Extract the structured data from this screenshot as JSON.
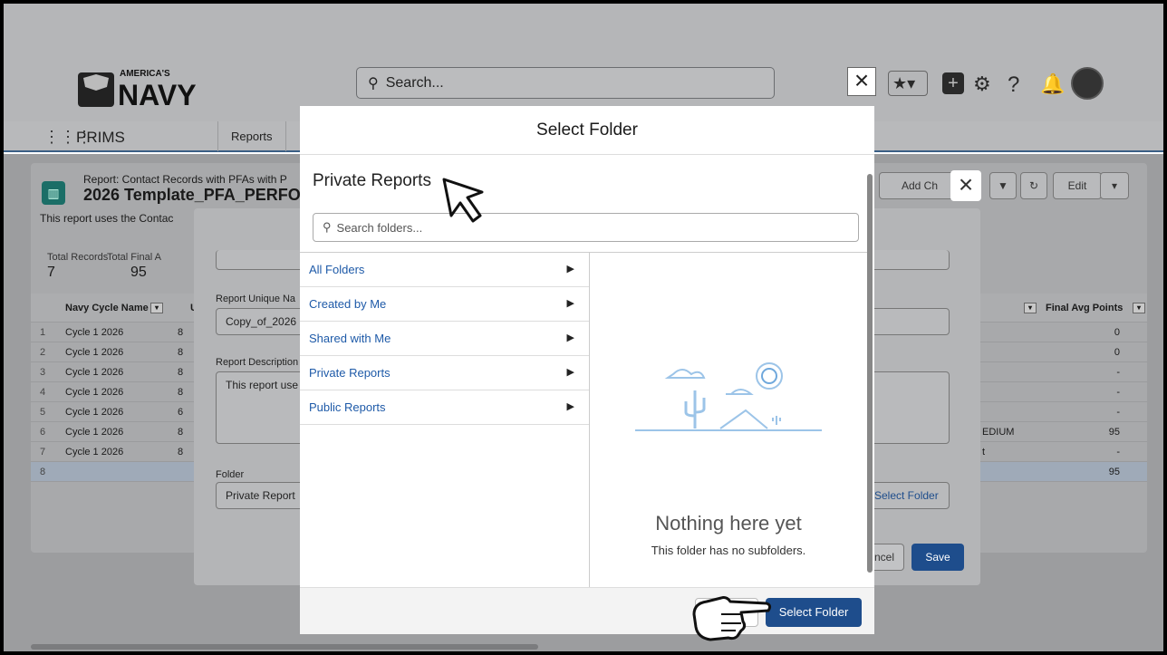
{
  "header": {
    "logo_text": "AMERICA'S NAVY",
    "search_placeholder": "Search...",
    "close_label": "×",
    "help_label": "?"
  },
  "nav": {
    "app_name": "PRIMS",
    "tab_reports": "Reports"
  },
  "report": {
    "subtitle": "Report: Contact Records with PFAs with P",
    "title": "2026 Template_PFA_PERFO",
    "description": "This report uses the Contac",
    "stats": [
      {
        "label": "Total Records",
        "value": "7"
      },
      {
        "label": "Total Final A",
        "value": "95"
      }
    ],
    "add_chart": "Add Ch",
    "edit": "Edit",
    "columns": {
      "cycle": "Navy Cycle Name",
      "u": "U",
      "final": "Final Avg Points"
    },
    "rows": [
      {
        "n": "1",
        "cycle": "Cycle 1 2026",
        "u": "8",
        "mid": "",
        "final": "0"
      },
      {
        "n": "2",
        "cycle": "Cycle 1 2026",
        "u": "8",
        "mid": "",
        "final": "0"
      },
      {
        "n": "3",
        "cycle": "Cycle 1 2026",
        "u": "8",
        "mid": "",
        "final": "-"
      },
      {
        "n": "4",
        "cycle": "Cycle 1 2026",
        "u": "8",
        "mid": "",
        "final": "-"
      },
      {
        "n": "5",
        "cycle": "Cycle 1 2026",
        "u": "6",
        "mid": "",
        "final": "-"
      },
      {
        "n": "6",
        "cycle": "Cycle 1 2026",
        "u": "8",
        "mid": "EDIUM",
        "final": "95"
      },
      {
        "n": "7",
        "cycle": "Cycle 1 2026",
        "u": "8",
        "mid": "t",
        "final": "-"
      },
      {
        "n": "8",
        "cycle": "",
        "u": "",
        "mid": "",
        "final": "95"
      }
    ]
  },
  "save_dialog": {
    "unique_name_label": "Report Unique Na",
    "unique_name_value": "Copy_of_2026",
    "description_label": "Report Description",
    "description_value": "This report use",
    "folder_label": "Folder",
    "folder_value": "Private Report",
    "select_folder_button": "Select Folder",
    "cancel": "ncel",
    "save": "Save"
  },
  "modal": {
    "title": "Select Folder",
    "section_title": "Private Reports",
    "search_placeholder": "Search folders...",
    "folders": [
      "All Folders",
      "Created by Me",
      "Shared with Me",
      "Private Reports",
      "Public Reports"
    ],
    "empty_title": "Nothing here yet",
    "empty_subtitle": "This folder has no subfolders.",
    "select_button": "Select Folder",
    "cancel_button": ""
  }
}
